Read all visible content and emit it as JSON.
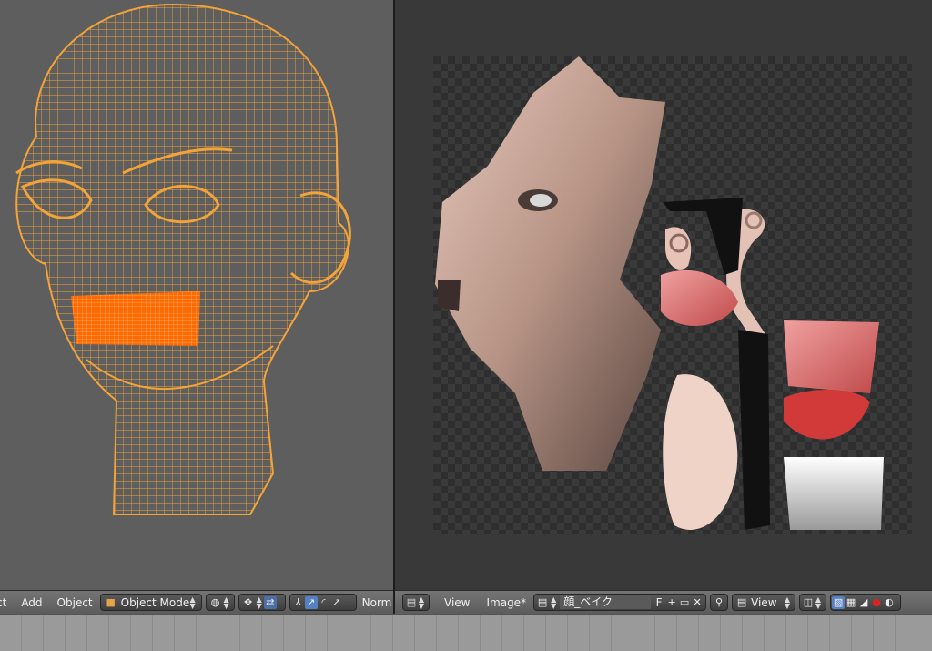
{
  "viewport3d": {
    "menu": [
      "ct",
      "Add",
      "Object"
    ],
    "mode_label": "Object Mode",
    "orientation_label": "Norm"
  },
  "image_editor": {
    "menu": [
      "View",
      "Image*"
    ],
    "image_name": "顔_ベイク",
    "fake_user": "F",
    "view_label": "View"
  },
  "colors": {
    "wire": "#f2a33a",
    "wire_selected": "#ff6a00",
    "skin": "#c9a79a",
    "lip": "#e27a79"
  }
}
